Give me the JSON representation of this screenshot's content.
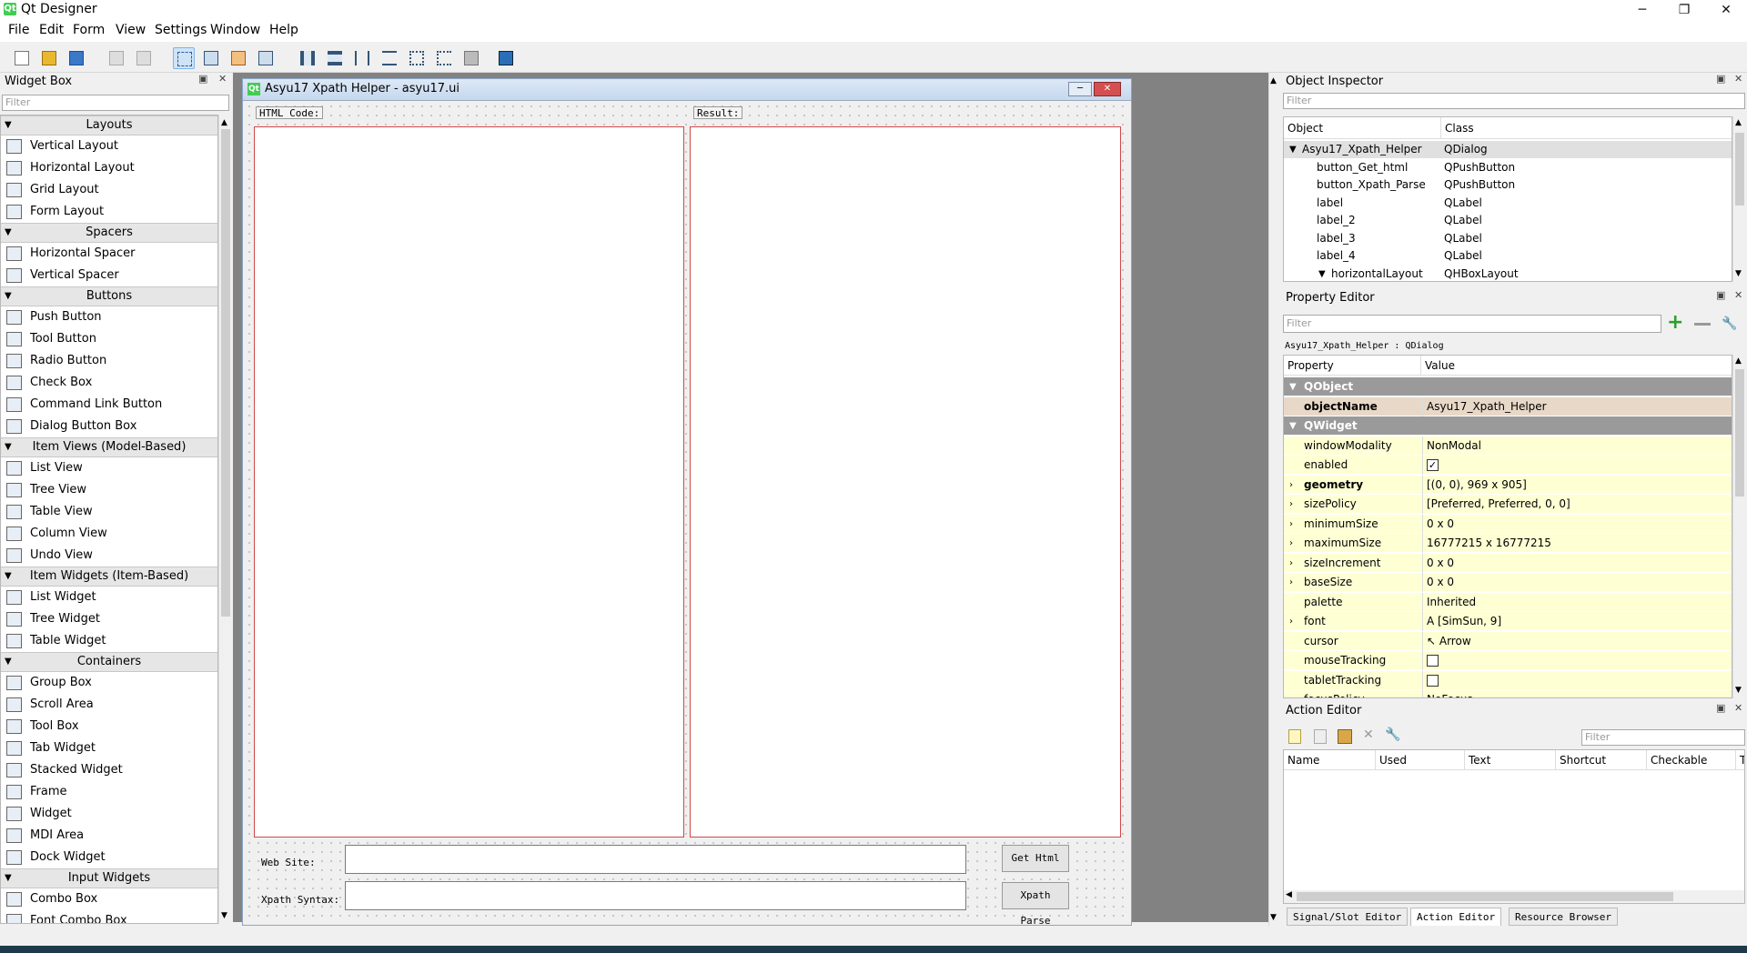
{
  "app": {
    "title": "Qt Designer",
    "logo": "Qt"
  },
  "window_controls": {
    "minimize": "─",
    "restore": "❐",
    "close": "✕"
  },
  "menubar": [
    "File",
    "Edit",
    "Form",
    "View",
    "Settings",
    "Window",
    "Help"
  ],
  "toolbar_icons": [
    "new-form-icon",
    "open-form-icon",
    "save-form-icon",
    "send-to-back-icon",
    "bring-to-front-icon",
    "edit-widgets-icon",
    "edit-signals-slots-icon",
    "edit-buddies-icon",
    "edit-tab-order-icon",
    "layout-horizontally-icon",
    "layout-vertically-icon",
    "layout-horizontal-splitter-icon",
    "layout-vertical-splitter-icon",
    "layout-grid-icon",
    "layout-form-icon",
    "break-layout-icon",
    "adjust-size-icon"
  ],
  "widget_box": {
    "title": "Widget Box",
    "filter_placeholder": "Filter",
    "categories": [
      {
        "name": "Layouts",
        "items": [
          "Vertical Layout",
          "Horizontal Layout",
          "Grid Layout",
          "Form Layout"
        ]
      },
      {
        "name": "Spacers",
        "items": [
          "Horizontal Spacer",
          "Vertical Spacer"
        ]
      },
      {
        "name": "Buttons",
        "items": [
          "Push Button",
          "Tool Button",
          "Radio Button",
          "Check Box",
          "Command Link Button",
          "Dialog Button Box"
        ]
      },
      {
        "name": "Item Views (Model-Based)",
        "items": [
          "List View",
          "Tree View",
          "Table View",
          "Column View",
          "Undo View"
        ]
      },
      {
        "name": "Item Widgets (Item-Based)",
        "items": [
          "List Widget",
          "Tree Widget",
          "Table Widget"
        ]
      },
      {
        "name": "Containers",
        "items": [
          "Group Box",
          "Scroll Area",
          "Tool Box",
          "Tab Widget",
          "Stacked Widget",
          "Frame",
          "Widget",
          "MDI Area",
          "Dock Widget"
        ]
      },
      {
        "name": "Input Widgets",
        "items": [
          "Combo Box",
          "Font Combo Box"
        ]
      }
    ]
  },
  "form": {
    "title": "Asyu17 Xpath Helper - asyu17.ui",
    "html_label": "HTML Code:",
    "result_label": "Result:",
    "website_label": "Web Site:",
    "xpath_label": "Xpath Syntax:",
    "website_value": "",
    "xpath_value": "",
    "get_html_button": "Get Html",
    "xpath_parse_button": "Xpath Parse"
  },
  "object_inspector": {
    "title": "Object Inspector",
    "filter_placeholder": "Filter",
    "col_object": "Object",
    "col_class": "Class",
    "rows": [
      {
        "object": "Asyu17_Xpath_Helper",
        "class": "QDialog"
      },
      {
        "object": "button_Get_html",
        "class": "QPushButton"
      },
      {
        "object": "button_Xpath_Parse",
        "class": "QPushButton"
      },
      {
        "object": "label",
        "class": "QLabel"
      },
      {
        "object": "label_2",
        "class": "QLabel"
      },
      {
        "object": "label_3",
        "class": "QLabel"
      },
      {
        "object": "label_4",
        "class": "QLabel"
      },
      {
        "object": "horizontalLayout",
        "class": "QHBoxLayout"
      }
    ]
  },
  "property_editor": {
    "title": "Property Editor",
    "filter_placeholder": "Filter",
    "context": "Asyu17_Xpath_Helper : QDialog",
    "col_property": "Property",
    "col_value": "Value",
    "rows": [
      {
        "name": "QObject",
        "value": "",
        "kind": "section"
      },
      {
        "name": "objectName",
        "value": "Asyu17_Xpath_Helper",
        "kind": "tan",
        "bold": true
      },
      {
        "name": "QWidget",
        "value": "",
        "kind": "section"
      },
      {
        "name": "windowModality",
        "value": "NonModal",
        "kind": "y"
      },
      {
        "name": "enabled",
        "value": "✓",
        "kind": "y",
        "check": true
      },
      {
        "name": "geometry",
        "value": "[(0, 0), 969 x 905]",
        "kind": "y",
        "bold": true,
        "expand": true
      },
      {
        "name": "sizePolicy",
        "value": "[Preferred, Preferred, 0, 0]",
        "kind": "y",
        "expand": true
      },
      {
        "name": "minimumSize",
        "value": "0 x 0",
        "kind": "y",
        "expand": true
      },
      {
        "name": "maximumSize",
        "value": "16777215 x 16777215",
        "kind": "y",
        "expand": true
      },
      {
        "name": "sizeIncrement",
        "value": "0 x 0",
        "kind": "y",
        "expand": true
      },
      {
        "name": "baseSize",
        "value": "0 x 0",
        "kind": "y",
        "expand": true
      },
      {
        "name": "palette",
        "value": "Inherited",
        "kind": "y"
      },
      {
        "name": "font",
        "value": "A  [SimSun, 9]",
        "kind": "y",
        "expand": true
      },
      {
        "name": "cursor",
        "value": "↖  Arrow",
        "kind": "y"
      },
      {
        "name": "mouseTracking",
        "value": "",
        "kind": "y",
        "check": true
      },
      {
        "name": "tabletTracking",
        "value": "",
        "kind": "y",
        "check": true
      },
      {
        "name": "focusPolicy",
        "value": "NoFocus",
        "kind": "y"
      }
    ]
  },
  "action_editor": {
    "title": "Action Editor",
    "filter_placeholder": "Filter",
    "columns": [
      "Name",
      "Used",
      "Text",
      "Shortcut",
      "Checkable",
      "T"
    ]
  },
  "bottom_tabs": [
    "Signal/Slot Editor",
    "Action Editor",
    "Resource Browser"
  ],
  "colors": {
    "accent": "#cfe3f7",
    "property_yellow": "#ffffd4",
    "section_gray": "#9a9a9a",
    "canvas": "#828282"
  }
}
